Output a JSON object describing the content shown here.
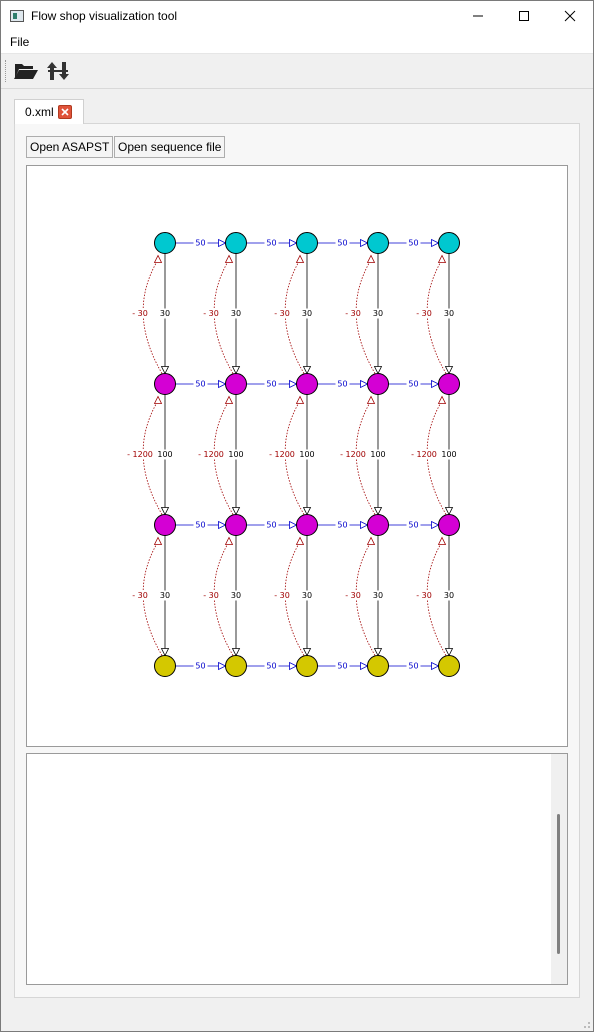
{
  "window": {
    "title": "Flow shop visualization tool",
    "controls": [
      "minimize",
      "maximize",
      "close"
    ]
  },
  "menu": {
    "items": [
      "File"
    ]
  },
  "toolbar": {
    "icons": [
      "open-folder-icon",
      "reorder-arrows-icon"
    ]
  },
  "tabs": [
    {
      "label": "0.xml",
      "closable": true
    }
  ],
  "buttons": {
    "open_asapst": "Open ASAPST",
    "open_sequence": "Open sequence file"
  },
  "graph": {
    "columns": 5,
    "rows": [
      {
        "color": "#00c8d0"
      },
      {
        "color": "#d400d4"
      },
      {
        "color": "#d400d4"
      },
      {
        "color": "#d4c800"
      }
    ],
    "horizontal_label": "50",
    "horizontal_color": "#0000cc",
    "vertical_forward_labels": [
      "30",
      "100",
      "30"
    ],
    "vertical_backward_labels": [
      "- 30",
      "- 1200",
      "- 30"
    ],
    "backward_color": "#a00000"
  },
  "log": {
    "text": ""
  }
}
